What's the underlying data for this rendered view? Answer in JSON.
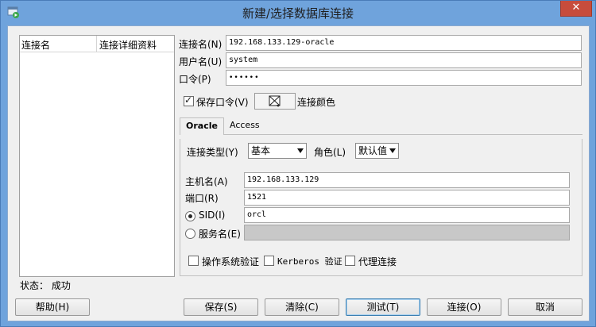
{
  "window": {
    "title": "新建/选择数据库连接",
    "close_glyph": "✕",
    "accent": "#6fa3dc",
    "close_color": "#c74c3c"
  },
  "connection_list": {
    "columns": [
      "连接名",
      "连接详细资料"
    ]
  },
  "form": {
    "conn_name_label": "连接名(N)",
    "conn_name_value": "192.168.133.129-oracle",
    "user_label": "用户名(U)",
    "user_value": "system",
    "password_label": "口令(P)",
    "password_value": "••••••",
    "save_password_label": "保存口令(V)",
    "save_password_checked": true,
    "conn_color_label": "连接颜色"
  },
  "tabs": [
    {
      "label": "Oracle",
      "active": true
    },
    {
      "label": "Access",
      "active": false
    }
  ],
  "oracle": {
    "conn_type_label": "连接类型(Y)",
    "conn_type_value": "基本",
    "role_label": "角色(L)",
    "role_value": "默认值",
    "host_label": "主机名(A)",
    "host_value": "192.168.133.129",
    "port_label": "端口(R)",
    "port_value": "1521",
    "sid_label": "SID(I)",
    "sid_value": "orcl",
    "sid_selected": true,
    "service_label": "服务名(E)",
    "service_value": "",
    "os_auth_label": "操作系统验证",
    "kerberos_label": "Kerberos 验证",
    "proxy_label": "代理连接"
  },
  "status": {
    "text": "状态： 成功"
  },
  "buttons": {
    "help": "帮助(H)",
    "save": "保存(S)",
    "clear": "清除(C)",
    "test": "测试(T)",
    "connect": "连接(O)",
    "cancel": "取消"
  }
}
